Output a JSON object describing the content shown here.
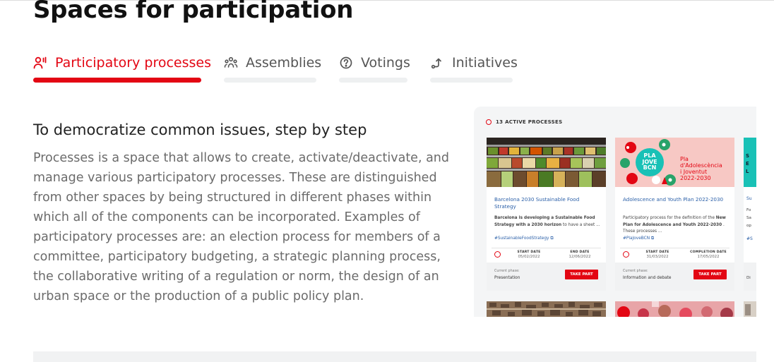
{
  "page": {
    "title": "Spaces for participation"
  },
  "tabs": [
    {
      "label": "Participatory processes",
      "icon": "participants-icon",
      "active": true
    },
    {
      "label": "Assemblies",
      "icon": "assembly-icon",
      "active": false
    },
    {
      "label": "Votings",
      "icon": "question-circle-icon",
      "active": false
    },
    {
      "label": "Initiatives",
      "icon": "initiative-arrow-icon",
      "active": false
    }
  ],
  "section": {
    "subtitle": "To democratize common issues, step by step",
    "description": "Processes is a space that allows to create, activate/deactivate, and manage various participatory processes. These are distinguished from other spaces by being structured in different phases within which all of the components can be incorporated. Examples of participatory processes are: an election process for members of a committee, participatory budgeting, a strategic planning process, the collaborative writing of a regulation or norm, the design of an urban space or the production of a public policy plan."
  },
  "preview": {
    "active_count_label": "13 ACTIVE PROCESSES",
    "cards": [
      {
        "title": "Barcelona 2030 Sustainable Food Strategy",
        "body_bold": "Barcelona is developing a Sustainable Food Strategy with a 2030 horizon",
        "body_rest": " to have a sheet ...",
        "tag": "#SustainableFoodStrategy ⧉",
        "date1_label": "START DATE",
        "date1_value": "05/02/2022",
        "date2_label": "END DATE",
        "date2_value": "12/06/2022",
        "phase_label": "Current phase:",
        "phase_value": "Presentation",
        "button": "TAKE PART"
      },
      {
        "title": "Adolescence and Youth Plan 2022-2030",
        "body_pre": "Participatory process for the definition of the ",
        "body_bold": "New Plan for Adolescence and Youth 2022-2030",
        "body_rest": " . These processes ...",
        "tag": "#PlaJoveBCN ⧉",
        "date1_label": "START DATE",
        "date1_value": "31/03/2022",
        "date2_label": "COMPLETION DATE",
        "date2_value": "17/05/2022",
        "phase_label": "Current phase:",
        "phase_value": "Information and debate",
        "button": "TAKE PART",
        "poster": {
          "badge_lines": [
            "PLA",
            "JOVE",
            "BCN"
          ],
          "caption_lines": [
            "Pla",
            "d'Adolescència",
            "i Joventut",
            "2022-2030"
          ]
        }
      }
    ],
    "partial_card": {
      "image_letters": [
        "S",
        "E",
        "L"
      ],
      "title_fragment": "Su",
      "body_fragments": [
        "Fo",
        "Sa",
        "op"
      ],
      "tag_fragment": "#S",
      "phase_fragment": "Di"
    }
  },
  "colors": {
    "accent": "#e30613",
    "link": "#2a5fa8",
    "text_muted": "#6b6b6b",
    "tab_inactive_bar": "#eef0f1",
    "poster_teal": "#19c1b6",
    "poster_pink": "#f7c8c4",
    "poster_green": "#29a36a"
  }
}
